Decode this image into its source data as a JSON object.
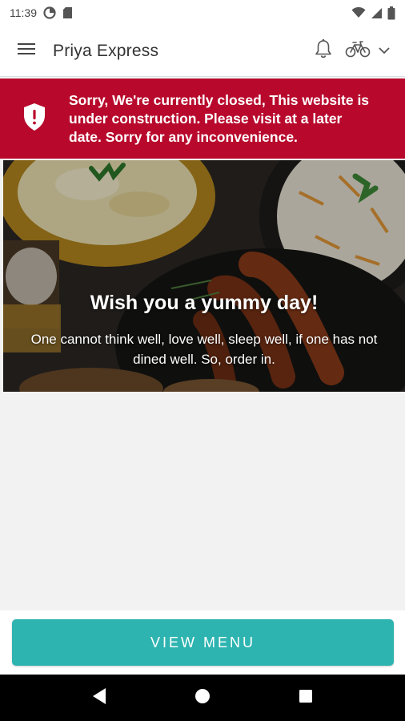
{
  "status_bar": {
    "time": "11:39",
    "icons": [
      "data-saver-icon",
      "sd-card-icon",
      "wifi-icon",
      "signal-icon",
      "battery-icon"
    ]
  },
  "app_bar": {
    "title": "Priya Express",
    "icons": [
      "hamburger-menu-icon",
      "bell-icon",
      "bicycle-icon",
      "chevron-down-icon"
    ]
  },
  "alert": {
    "message": "Sorry, We're currently closed, This website is under construction. Please visit at a later date. Sorry for any inconvenience.",
    "icon": "shield-alert-icon",
    "color": "#b8092c"
  },
  "hero": {
    "title": "Wish you a yummy day!",
    "subtitle": "One cannot think well, love well, sleep well, if one has not dined well. So, order in."
  },
  "cta": {
    "label": "VIEW MENU",
    "color": "#2eb4b0"
  },
  "nav_bar": {
    "icons": [
      "back-icon",
      "home-icon",
      "recents-icon"
    ]
  }
}
